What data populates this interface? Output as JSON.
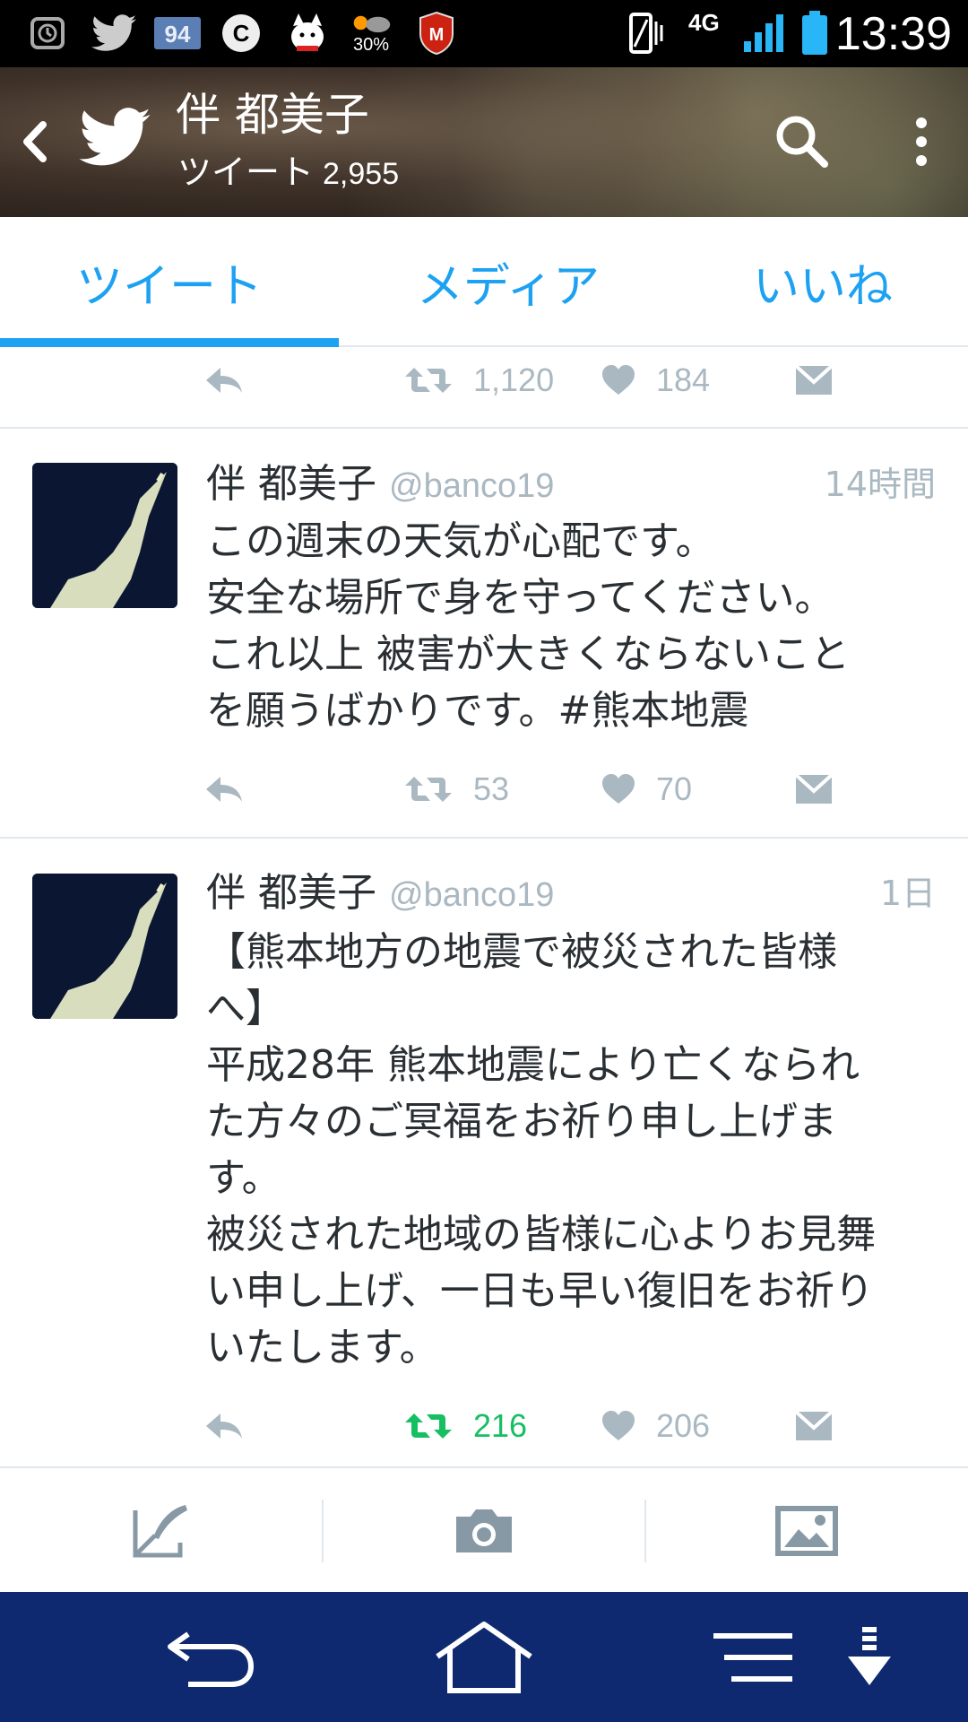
{
  "status_bar": {
    "battery_saver": "30%",
    "network": "4G",
    "time": "13:39"
  },
  "header": {
    "title": "伴 都美子",
    "subtitle_label": "ツイート",
    "tweet_count": "2,955"
  },
  "tabs": [
    {
      "label": "ツイート",
      "active": true
    },
    {
      "label": "メディア",
      "active": false
    },
    {
      "label": "いいね",
      "active": false
    }
  ],
  "tweets": [
    {
      "partial": true,
      "retweets": "1,120",
      "likes": "184",
      "retweeted": false
    },
    {
      "name": "伴 都美子",
      "handle": "@banco19",
      "time": "14時間",
      "text": "この週末の天気が心配です。\n安全な場所で身を守ってください。\nこれ以上 被害が大きくならないこと\nを願うばかりです。#熊本地震",
      "retweets": "53",
      "likes": "70",
      "retweeted": false
    },
    {
      "name": "伴 都美子",
      "handle": "@banco19",
      "time": "1日",
      "text": "【熊本地方の地震で被災された皆様\nへ】\n平成28年 熊本地震により亡くなられ\nた方々のご冥福をお祈り申し上げま\nす。\n被災された地域の皆様に心よりお見舞\nい申し上げ、一日も早い復旧をお祈り\nいたします。",
      "retweets": "216",
      "likes": "206",
      "retweeted": true
    }
  ],
  "colors": {
    "accent": "#1da1f2",
    "muted": "#aab8c2",
    "retweet_active": "#17bf63",
    "navbar": "#0e2970"
  },
  "icons": {
    "compose": "compose-tweet-icon",
    "camera": "camera-icon",
    "gallery": "image-icon"
  }
}
